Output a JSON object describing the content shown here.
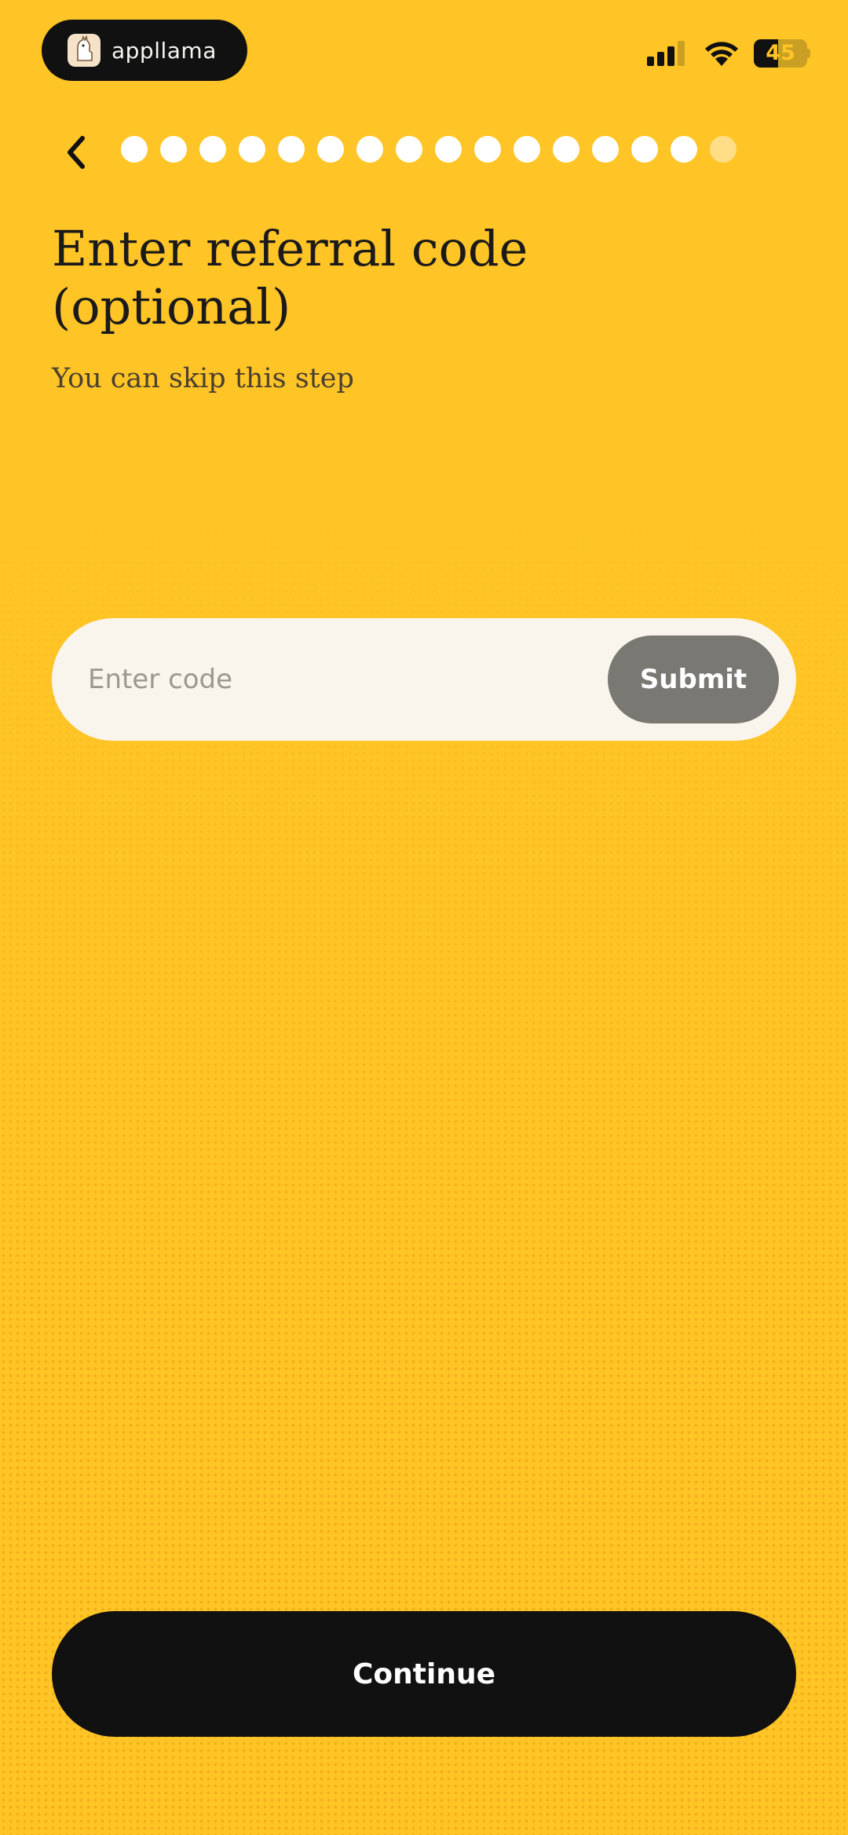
{
  "status_bar": {
    "app_name": "appllama",
    "app_icon": "llama-logo-icon",
    "battery_level": "45",
    "battery_fraction": 0.45,
    "icons": [
      "signal-bars-icon",
      "wifi-icon",
      "battery-icon"
    ]
  },
  "navigation": {
    "back_icon": "chevron-left-icon",
    "progress": {
      "completed_steps": 15,
      "total_steps": 16
    }
  },
  "header": {
    "title": "Enter referral code\n(optional)",
    "subtitle": "You can skip this step"
  },
  "referral_form": {
    "placeholder": "Enter code",
    "value": "",
    "submit_label": "Submit"
  },
  "footer": {
    "continue_label": "Continue"
  },
  "colors": {
    "background": "#FFC426",
    "primary_button": "#111111",
    "submit_button": "#7A7873",
    "input_background": "#FAF5EC"
  }
}
